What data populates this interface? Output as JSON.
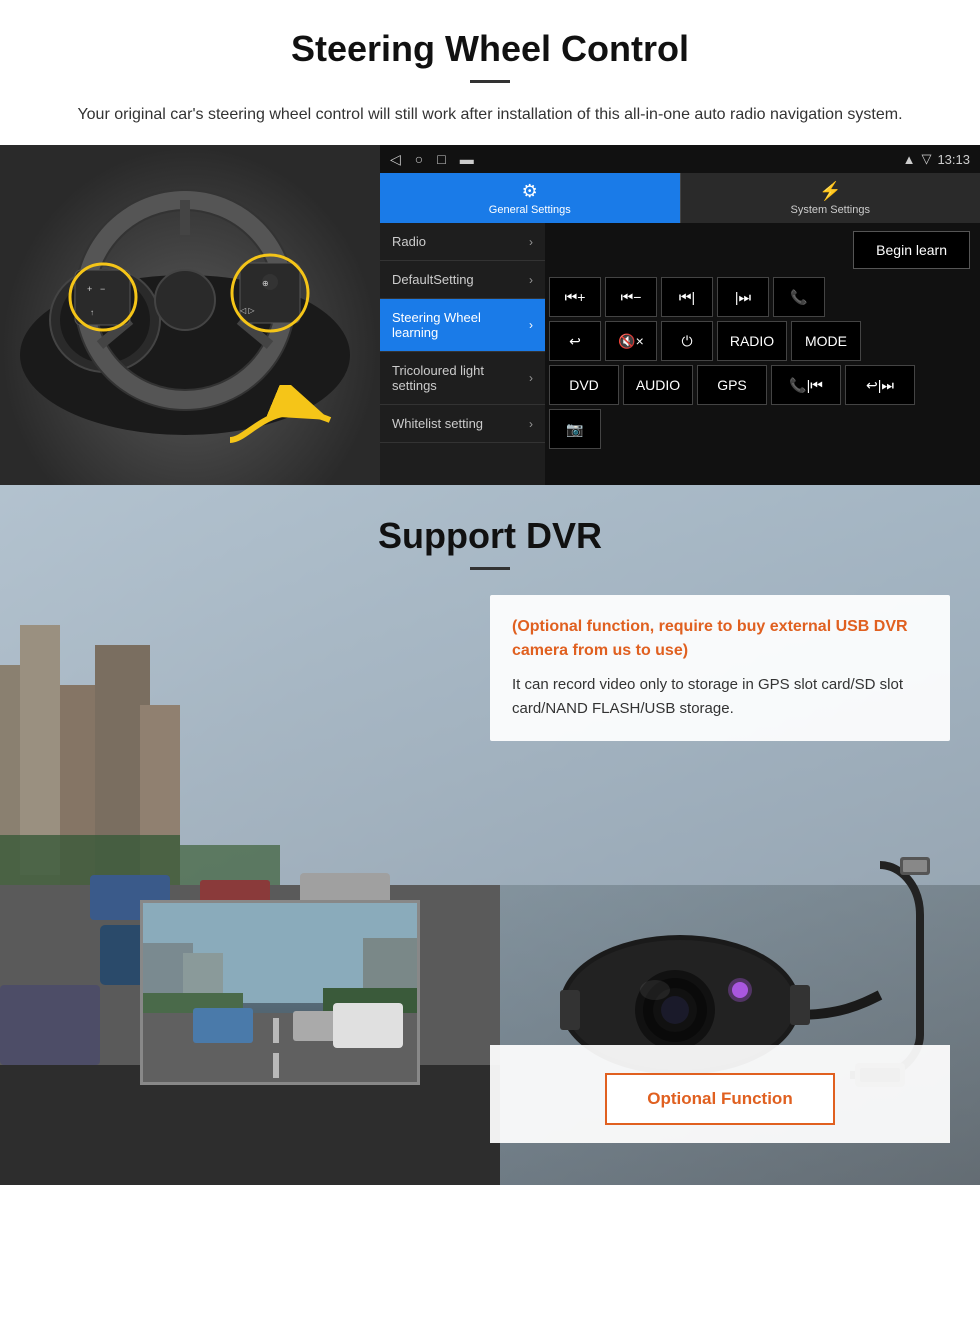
{
  "steering_wheel": {
    "title": "Steering Wheel Control",
    "subtitle": "Your original car's steering wheel control will still work after installation of this all-in-one auto radio navigation system.",
    "android_ui": {
      "time": "13:13",
      "tab_general": "General Settings",
      "tab_system": "System Settings",
      "menu_items": [
        {
          "label": "Radio",
          "active": false
        },
        {
          "label": "DefaultSetting",
          "active": false
        },
        {
          "label": "Steering Wheel learning",
          "active": true
        },
        {
          "label": "Tricoloured light settings",
          "active": false
        },
        {
          "label": "Whitelist setting",
          "active": false
        }
      ],
      "begin_learn": "Begin learn",
      "control_buttons": {
        "row1": [
          "⏮+",
          "⏮−",
          "⏮|",
          "|⏭",
          "📞"
        ],
        "row2": [
          "↩",
          "🔇×",
          "⏻",
          "RADIO",
          "MODE"
        ],
        "row3": [
          "DVD",
          "AUDIO",
          "GPS",
          "📞|⏮",
          "↩|⏭"
        ],
        "row4": [
          "📷"
        ]
      }
    }
  },
  "dvr": {
    "title": "Support DVR",
    "optional_text": "(Optional function, require to buy external USB DVR camera from us to use)",
    "description": "It can record video only to storage in GPS slot card/SD slot card/NAND FLASH/USB storage.",
    "optional_button": "Optional Function"
  }
}
